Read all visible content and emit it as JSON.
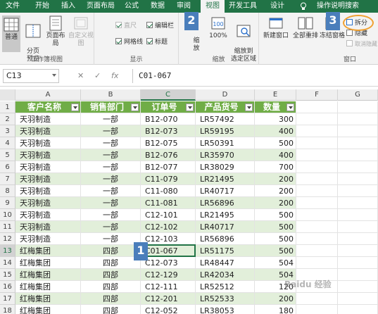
{
  "tabs": [
    "文件",
    "开始",
    "插入",
    "页面布局",
    "公式",
    "数据",
    "审阅",
    "视图",
    "开发工具",
    "设计",
    "操作说明搜索"
  ],
  "active_tab": "视图",
  "ribbon": {
    "workbook_views": {
      "normal": "普通",
      "page_break": "分页\n预览",
      "page_layout": "页面布局",
      "custom": "自定义视图",
      "group_label": "工作簿视图"
    },
    "show": {
      "ruler": "直尺",
      "formula_bar": "编辑栏",
      "gridlines": "网格线",
      "headings": "标题",
      "group_label": "显示"
    },
    "zoom": {
      "zoom": "缩\n放",
      "hundred": "100%",
      "zoom_selection": "缩放到\n选定区域",
      "group_label": "缩放"
    },
    "window": {
      "new_window": "新建窗口",
      "arrange_all": "全部重排",
      "freeze_panes": "冻结窗格",
      "split": "拆分",
      "hide": "隐藏",
      "unhide": "取消隐藏",
      "group_label": "窗口"
    }
  },
  "callouts": [
    "1",
    "2",
    "3"
  ],
  "formula_bar": {
    "name_box": "C13",
    "fx": "fx",
    "value": "C01-067"
  },
  "columns": [
    "A",
    "B",
    "C",
    "D",
    "E",
    "F",
    "G"
  ],
  "selected_column": "C",
  "rows": [
    "1",
    "2",
    "3",
    "4",
    "5",
    "6",
    "7",
    "8",
    "9",
    "10",
    "11",
    "12",
    "13",
    "14",
    "15",
    "16",
    "17",
    "18"
  ],
  "selected_row": "13",
  "table": {
    "headers": [
      "客户名称",
      "销售部门",
      "订单号",
      "产品货号",
      "数量"
    ],
    "data": [
      [
        "天羽制造",
        "一部",
        "B12-070",
        "LR57492",
        "300"
      ],
      [
        "天羽制造",
        "一部",
        "B12-073",
        "LR59195",
        "400"
      ],
      [
        "天羽制造",
        "一部",
        "B12-075",
        "LR50391",
        "500"
      ],
      [
        "天羽制造",
        "一部",
        "B12-076",
        "LR35970",
        "400"
      ],
      [
        "天羽制造",
        "一部",
        "B12-077",
        "LR38029",
        "700"
      ],
      [
        "天羽制造",
        "一部",
        "C11-079",
        "LR21495",
        "200"
      ],
      [
        "天羽制造",
        "一部",
        "C11-080",
        "LR40717",
        "200"
      ],
      [
        "天羽制造",
        "一部",
        "C11-081",
        "LR56896",
        "200"
      ],
      [
        "天羽制造",
        "一部",
        "C12-101",
        "LR21495",
        "500"
      ],
      [
        "天羽制造",
        "一部",
        "C12-102",
        "LR40717",
        "500"
      ],
      [
        "天羽制造",
        "一部",
        "C12-103",
        "LR56896",
        "500"
      ],
      [
        "红梅集团",
        "四部",
        "C01-067",
        "LR51175",
        "500"
      ],
      [
        "红梅集团",
        "四部",
        "C12-073",
        "LR48447",
        "504"
      ],
      [
        "红梅集团",
        "四部",
        "C12-129",
        "LR42034",
        "504"
      ],
      [
        "红梅集团",
        "四部",
        "C12-111",
        "LR52512",
        "120"
      ],
      [
        "红梅集团",
        "四部",
        "C12-201",
        "LR52533",
        "200"
      ],
      [
        "红梅集团",
        "四部",
        "C12-052",
        "LR38053",
        "180"
      ]
    ]
  },
  "watermark": "Baidu 经验",
  "colors": {
    "excel_green": "#217346",
    "table_header": "#70ad47",
    "band": "#e2efda",
    "callout": "#4a7ebb",
    "circle": "#f0a030"
  }
}
